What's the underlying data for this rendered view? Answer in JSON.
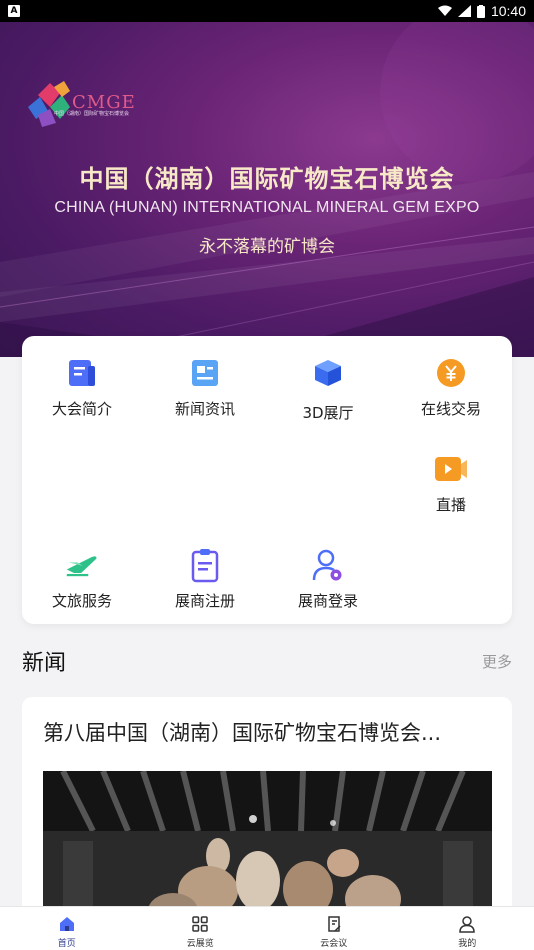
{
  "status_bar": {
    "time": "10:40",
    "notification_badge": "A"
  },
  "banner": {
    "logo_text": "CMGE",
    "logo_sub": "中国（湖南）国际矿物宝石博览会",
    "title_cn": "中国（湖南）国际矿物宝石博览会",
    "title_en": "CHINA (HUNAN) INTERNATIONAL MINERAL GEM EXPO",
    "slogan": "永不落幕的矿博会"
  },
  "menu": {
    "items": [
      {
        "label": "大会简介",
        "icon": "document-icon"
      },
      {
        "label": "新闻资讯",
        "icon": "news-icon"
      },
      {
        "label": "3D展厅",
        "icon": "cube-icon"
      },
      {
        "label": "在线交易",
        "icon": "yuan-coin-icon"
      },
      {
        "label": "直播",
        "icon": "video-camera-icon"
      },
      {
        "label": "文旅服务",
        "icon": "airplane-icon"
      },
      {
        "label": "展商注册",
        "icon": "clipboard-icon"
      },
      {
        "label": "展商登录",
        "icon": "user-login-icon"
      }
    ]
  },
  "news": {
    "section_title": "新闻",
    "more_label": "更多",
    "items": [
      {
        "headline": "第八届中国（湖南）国际矿物宝石博览会..."
      }
    ]
  },
  "tabbar": {
    "tabs": [
      {
        "label": "首页",
        "icon": "home-icon",
        "active": true
      },
      {
        "label": "云展览",
        "icon": "grid-icon",
        "active": false
      },
      {
        "label": "云会议",
        "icon": "meeting-icon",
        "active": false
      },
      {
        "label": "我的",
        "icon": "profile-icon",
        "active": false
      }
    ]
  },
  "colors": {
    "banner_purple": "#6a2476",
    "accent_blue": "#4f6ef7",
    "accent_orange": "#f59a23",
    "accent_green": "#2ec28a",
    "tab_active": "#2d3a8c"
  }
}
